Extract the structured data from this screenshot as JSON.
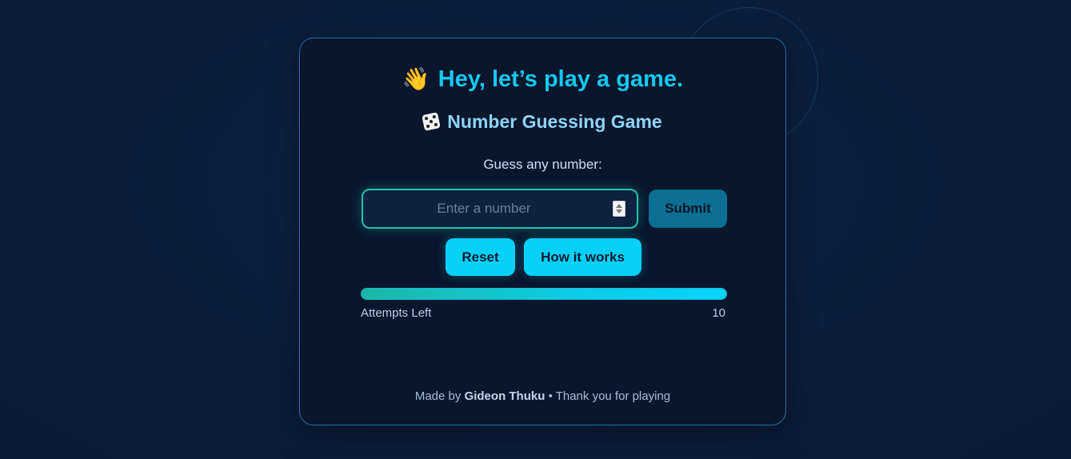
{
  "header": {
    "title": "Hey, let’s play a game.",
    "title_icon": "waving-hand-icon",
    "subtitle": "Number Guessing Game",
    "subtitle_icon": "die-icon"
  },
  "game": {
    "prompt": "Guess any number:",
    "input": {
      "placeholder": "Enter a number",
      "value": ""
    },
    "buttons": {
      "submit": "Submit",
      "reset": "Reset",
      "how": "How it works"
    },
    "attempts": {
      "label": "Attempts Left",
      "value": "10",
      "remaining_fraction": 1.0
    }
  },
  "footer": {
    "prefix": "Made by",
    "author": "Gideon Thuku",
    "suffix": "• Thank you for playing"
  },
  "colors": {
    "accent": "#06d0f8",
    "title": "#14c8f0",
    "input_border": "#1ec2b0",
    "submit_bg": "#0a6f92",
    "card_border": "#1f6fb0"
  }
}
